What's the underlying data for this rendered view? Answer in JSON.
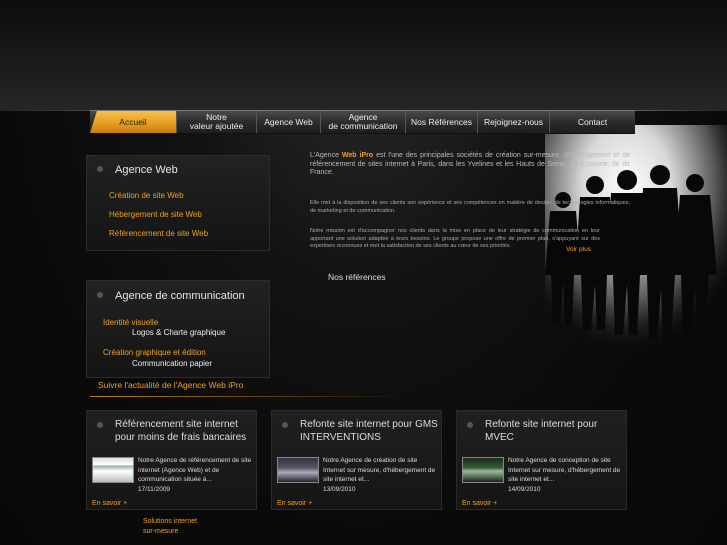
{
  "nav": {
    "items": [
      {
        "label": "Accueil"
      },
      {
        "label": "Notre\nvaleur ajoutée"
      },
      {
        "label": "Agence Web"
      },
      {
        "label": "Agence\nde communication"
      },
      {
        "label": "Nos Références"
      },
      {
        "label": "Rejoignez-nous"
      },
      {
        "label": "Contact"
      }
    ]
  },
  "agence_web": {
    "title": "Agence Web",
    "links": [
      "Création de site Web",
      "Hébergement de site Web",
      "Référencement de site Web"
    ]
  },
  "agence_com": {
    "title": "Agence de communication",
    "identity_link": "Identité visuelle",
    "identity_text": "Logos & Charte graphique",
    "graphic_link": "Création graphique et édition",
    "graphic_text": "Communication papier"
  },
  "intro": {
    "p1_pre": "L'Agence ",
    "p1_brand": "Web iPro",
    "p1_post": " est l'une des principales sociétés de création sur-mesure, d'hébergement et de référencement de sites internet à Paris, dans les Yvelines et les Hauts de Seine, en Essonne, Ile de France.",
    "p2": "Elle met à la disposition de ses clients son expérience et ses compétences en matière de design, de technologies informatiques, de marketing et de communication.",
    "p3": "Notre mission est d'accompagner nos clients dans la mise en place de leur stratégie de communication en leur apportant une solution adaptée à leurs besoins. Le groupe propose une offre de premier plan, s'appuyant sur des expertises reconnues et met la satisfaction de ses clients au cœur de ses priorités.",
    "voir_plus": "Voir plus",
    "references": "Nos références"
  },
  "follow": "Suivre l'actualité de l'Agence Web iPro",
  "news": [
    {
      "title": "Référencement site internet pour moins de frais bancaires",
      "text": "Notre Agence de référencement de site internet (Agence Web) et de communication située à...",
      "date": "17/11/2009",
      "more": "En savoir +"
    },
    {
      "title": "Refonte site internet pour GMS INTERVENTIONS",
      "text": "Notre Agence de création de site Internet sur mesure, d'hébergement de site internet et...",
      "date": "13/09/2010",
      "more": "En savoir +"
    },
    {
      "title": "Refonte site internet pour MVEC",
      "text": "Notre Agence de conception de site Internet sur mesure, d'hébergement de site internet et...",
      "date": "14/09/2010",
      "more": "En savoir +"
    }
  ],
  "footer": {
    "line1": "Solutions internet",
    "line2": "sur-mesure"
  }
}
